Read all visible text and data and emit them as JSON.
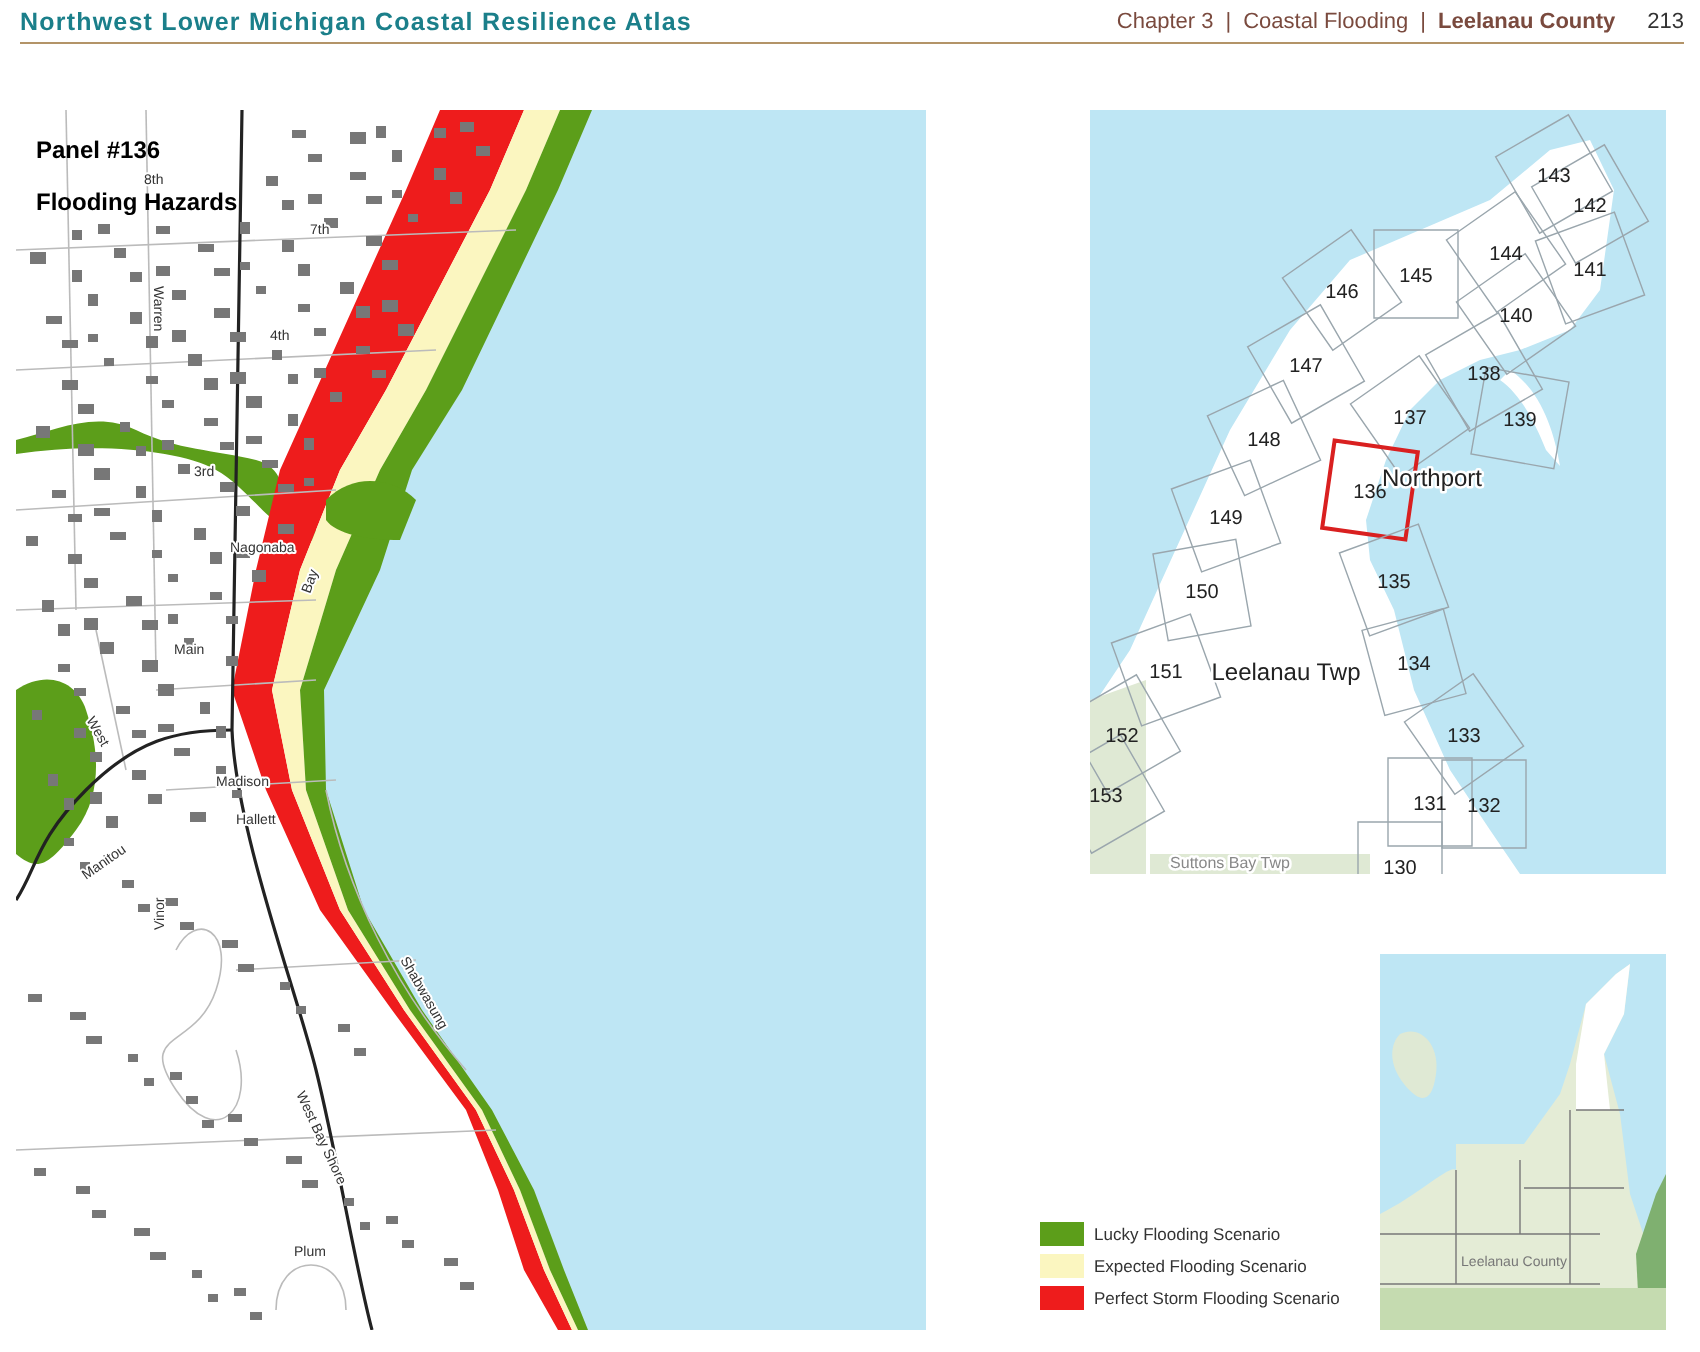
{
  "header": {
    "title": "Northwest Lower Michigan Coastal Resilience Atlas",
    "breadcrumbs": [
      {
        "text": "Chapter 3",
        "kind": "crumb"
      },
      {
        "text": "|",
        "kind": "sep"
      },
      {
        "text": "Coastal Flooding",
        "kind": "crumb"
      },
      {
        "text": "|",
        "kind": "sep"
      },
      {
        "text": "Leelanau County",
        "kind": "current"
      }
    ],
    "page_number": "213"
  },
  "map": {
    "panel_title": "Panel #136",
    "subtitle": "Flooding Hazards",
    "street_labels": [
      "8th",
      "7th",
      "4th",
      "3rd",
      "Warren",
      "Nagonaba",
      "Main",
      "Bay",
      "West",
      "Madison",
      "Hallett",
      "Manitou",
      "Vinor",
      "West Bay Shore",
      "Plum",
      "Shabwasung"
    ]
  },
  "index_map": {
    "panels": [
      {
        "label": "143",
        "selected": false
      },
      {
        "label": "142",
        "selected": false
      },
      {
        "label": "144",
        "selected": false
      },
      {
        "label": "141",
        "selected": false
      },
      {
        "label": "145",
        "selected": false
      },
      {
        "label": "146",
        "selected": false
      },
      {
        "label": "140",
        "selected": false
      },
      {
        "label": "147",
        "selected": false
      },
      {
        "label": "138",
        "selected": false
      },
      {
        "label": "139",
        "selected": false
      },
      {
        "label": "148",
        "selected": false
      },
      {
        "label": "137",
        "selected": false
      },
      {
        "label": "136",
        "selected": true
      },
      {
        "label": "149",
        "selected": false
      },
      {
        "label": "135",
        "selected": false
      },
      {
        "label": "150",
        "selected": false
      },
      {
        "label": "134",
        "selected": false
      },
      {
        "label": "151",
        "selected": false
      },
      {
        "label": "133",
        "selected": false
      },
      {
        "label": "152",
        "selected": false
      },
      {
        "label": "131",
        "selected": false
      },
      {
        "label": "132",
        "selected": false
      },
      {
        "label": "153",
        "selected": false
      },
      {
        "label": "130",
        "selected": false
      }
    ],
    "places": [
      "Northport",
      "Leelanau Twp",
      "Suttons Bay Twp"
    ]
  },
  "legend": [
    {
      "label": "Lucky Flooding Scenario",
      "color": "#5c9e1a"
    },
    {
      "label": "Expected Flooding Scenario",
      "color": "#fbf6c0"
    },
    {
      "label": "Perfect Storm Flooding Scenario",
      "color": "#ee1c1c"
    }
  ],
  "locator_map": {
    "label": "Leelanau County"
  }
}
